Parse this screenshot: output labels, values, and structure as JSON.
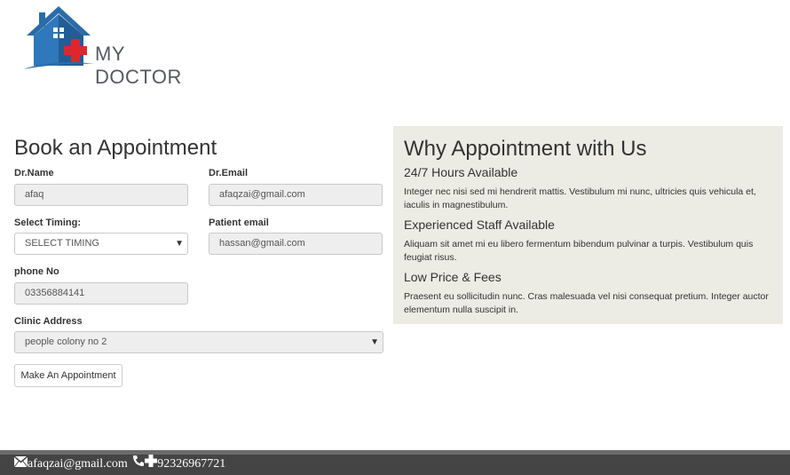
{
  "brand": {
    "name": "MY DOCTOR",
    "house_color": "#2b6ca8",
    "cross_color": "#e0262d"
  },
  "form": {
    "title": "Book an Appointment",
    "dr_name_label": "Dr.Name",
    "dr_name_value": "afaq",
    "dr_email_label": "Dr.Email",
    "dr_email_value": "afaqzai@gmail.com",
    "timing_label": "Select Timing:",
    "timing_value": "SELECT TIMING",
    "patient_email_label": "Patient email",
    "patient_email_value": "hassan@gmail.com",
    "phone_label": "phone No",
    "phone_value": "03356884141",
    "clinic_label": "Clinic Address",
    "clinic_value": "people colony no 2",
    "submit_label": "Make An Appointment"
  },
  "panel": {
    "title": "Why Appointment with Us",
    "items": [
      {
        "heading": "24/7 Hours Available",
        "text": "Integer nec nisi sed mi hendrerit mattis. Vestibulum mi nunc, ultricies quis vehicula et, iaculis in magnestibulum."
      },
      {
        "heading": "Experienced Staff Available",
        "text": "Aliquam sit amet mi eu libero fermentum bibendum pulvinar a turpis. Vestibulum quis feugiat risus."
      },
      {
        "heading": "Low Price & Fees",
        "text": "Praesent eu sollicitudin nunc. Cras malesuada vel nisi consequat pretium. Integer auctor elementum nulla suscipit in."
      }
    ],
    "background": "#ecebe4"
  },
  "footer": {
    "email": "afaqzai@gmail.com",
    "phone": "92326967721",
    "email_icon": "envelope-icon",
    "phone_icon": "phone-icon",
    "plus_icon": "plus-icon"
  }
}
